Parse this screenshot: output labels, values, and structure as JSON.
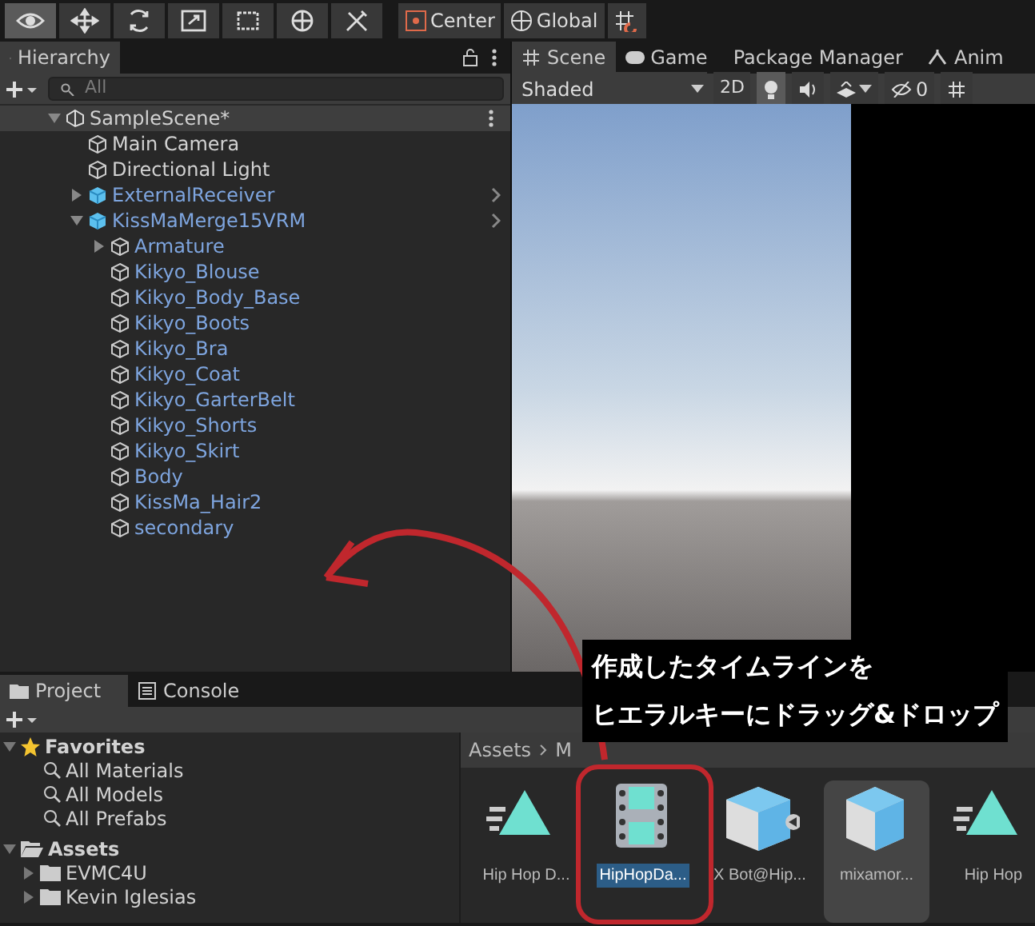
{
  "toolbar": {
    "tools": [
      {
        "kind": "view",
        "selected": true
      },
      {
        "kind": "move",
        "selected": false
      },
      {
        "kind": "rotate",
        "selected": false
      },
      {
        "kind": "scale",
        "selected": false
      },
      {
        "kind": "rect",
        "selected": false
      },
      {
        "kind": "transform",
        "selected": false
      },
      {
        "kind": "custom",
        "selected": false
      }
    ],
    "pivot": "Center",
    "space": "Global"
  },
  "hierarchy": {
    "tab": "Hierarchy",
    "search": {
      "placeholder": "All"
    },
    "items": [
      {
        "label": "SampleScene*",
        "kind": "scene",
        "expanded": true,
        "children": [
          {
            "label": "Main Camera",
            "kind": "object"
          },
          {
            "label": "Directional Light",
            "kind": "object"
          },
          {
            "label": "ExternalReceiver",
            "kind": "prefab",
            "expanded": false
          },
          {
            "label": "KissMaMerge15VRM",
            "kind": "prefab",
            "expanded": true,
            "children": [
              {
                "label": "Armature",
                "kind": "part",
                "expanded": false
              },
              {
                "label": "Kikyo_Blouse",
                "kind": "part"
              },
              {
                "label": "Kikyo_Body_Base",
                "kind": "part"
              },
              {
                "label": "Kikyo_Boots",
                "kind": "part"
              },
              {
                "label": "Kikyo_Bra",
                "kind": "part"
              },
              {
                "label": "Kikyo_Coat",
                "kind": "part"
              },
              {
                "label": "Kikyo_GarterBelt",
                "kind": "part"
              },
              {
                "label": "Kikyo_Shorts",
                "kind": "part"
              },
              {
                "label": "Kikyo_Skirt",
                "kind": "part"
              },
              {
                "label": "Body",
                "kind": "part"
              },
              {
                "label": "KissMa_Hair2",
                "kind": "part"
              },
              {
                "label": "secondary",
                "kind": "part"
              }
            ]
          }
        ]
      }
    ]
  },
  "scene_view": {
    "tabs": [
      {
        "label": "Scene",
        "kind": "scene",
        "selected": true
      },
      {
        "label": "Game",
        "kind": "game",
        "selected": false
      },
      {
        "label": "Package Manager",
        "kind": "package",
        "selected": false
      },
      {
        "label": "Anim",
        "kind": "anim",
        "selected": false
      }
    ],
    "shading": "Shaded",
    "mode_2d": "2D",
    "lighting_on": true,
    "hidden_count": "0"
  },
  "project": {
    "tabs": [
      {
        "label": "Project",
        "kind": "project",
        "selected": true
      },
      {
        "label": "Console",
        "kind": "console",
        "selected": false
      }
    ],
    "favorites": {
      "label": "Favorites",
      "expanded": true,
      "items": [
        "All Materials",
        "All Models",
        "All Prefabs"
      ]
    },
    "assets": {
      "label": "Assets",
      "expanded": true,
      "folders": [
        "EVMC4U",
        "Kevin Iglesias"
      ]
    },
    "breadcrumb": [
      "Assets",
      "M"
    ],
    "files": [
      {
        "label": "Hip Hop D...",
        "kind": "animation",
        "selected": false
      },
      {
        "label": "HipHopDa...",
        "kind": "timeline",
        "selected": true
      },
      {
        "label": "X Bot@Hip...",
        "kind": "model",
        "selected": false
      },
      {
        "label": "mixamor...",
        "kind": "submodel",
        "selected": false
      },
      {
        "label": "Hip Hop",
        "kind": "animation",
        "selected": false
      }
    ]
  },
  "annotation": {
    "lines": [
      "作成したタイムラインを",
      "ヒエラルキーにドラッグ&ドロップ"
    ]
  }
}
